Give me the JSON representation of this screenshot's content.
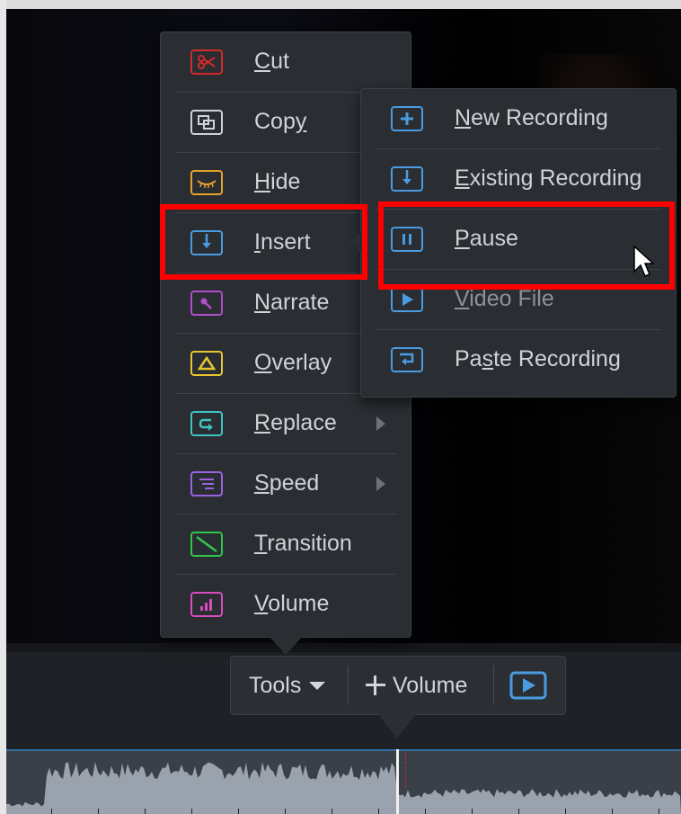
{
  "main_menu": {
    "items": [
      {
        "label": "Cut",
        "mnemonic": "C",
        "icon": "scissors-icon",
        "color": "#d22a2a",
        "submenu": false
      },
      {
        "label": "Copy",
        "mnemonic": "y",
        "icon": "copy-icon",
        "color": "#cfd3d7",
        "submenu": false
      },
      {
        "label": "Hide",
        "mnemonic": "H",
        "icon": "hide-eye-icon",
        "color": "#e6a32a",
        "submenu": false
      },
      {
        "label": "Insert",
        "mnemonic": "I",
        "icon": "insert-icon",
        "color": "#4a9be0",
        "submenu": true,
        "selected": true
      },
      {
        "label": "Narrate",
        "mnemonic": "N",
        "icon": "microphone-icon",
        "color": "#b04ec8",
        "submenu": false
      },
      {
        "label": "Overlay",
        "mnemonic": "O",
        "icon": "overlay-triangle-icon",
        "color": "#e7c531",
        "submenu": false
      },
      {
        "label": "Replace",
        "mnemonic": "R",
        "icon": "replace-icon",
        "color": "#3fc4c2",
        "submenu": true
      },
      {
        "label": "Speed",
        "mnemonic": "S",
        "icon": "speed-icon",
        "color": "#9a63e0",
        "submenu": true
      },
      {
        "label": "Transition",
        "mnemonic": "T",
        "icon": "transition-icon",
        "color": "#2ec84a",
        "submenu": false
      },
      {
        "label": "Volume",
        "mnemonic": "V",
        "icon": "volume-bars-icon",
        "color": "#d84cc0",
        "submenu": false
      }
    ]
  },
  "insert_submenu": {
    "items": [
      {
        "label": "New Recording",
        "mnemonic": "N",
        "icon": "plus-box-icon",
        "color": "#4a9be0"
      },
      {
        "label": "Existing Recording",
        "mnemonic": "E",
        "icon": "insert-icon",
        "color": "#4a9be0"
      },
      {
        "label": "Pause",
        "mnemonic": "P",
        "icon": "pause-icon",
        "color": "#4a9be0",
        "hovered": true
      },
      {
        "label": "Video File",
        "mnemonic": "V",
        "icon": "play-box-icon",
        "color": "#4a9be0"
      },
      {
        "label": "Paste Recording",
        "mnemonic": "s",
        "icon": "paste-icon",
        "color": "#4a9be0"
      }
    ]
  },
  "toolbar": {
    "tools_label": "Tools",
    "volume_label": "Volume",
    "icons": [
      "chevron-down-icon",
      "plus-icon",
      "play-box-icon"
    ]
  },
  "colors": {
    "highlight": "#ff0000",
    "menu_bg": "#2a2e33",
    "timeline_top": "#2f6da3"
  }
}
